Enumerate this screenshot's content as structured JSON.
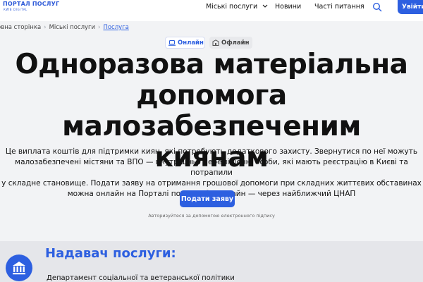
{
  "header": {
    "logo_title": "ПОРТАЛ ПОСЛУГ",
    "logo_subtitle": "КИЇВ DIGITAL",
    "nav": {
      "city_services": "Міські послуги",
      "news": "Новини",
      "faq": "Часті питання"
    },
    "login_label": "Увійти"
  },
  "breadcrumb": {
    "items": [
      "овна сторінка",
      "Міські послуги",
      "Послуга"
    ]
  },
  "mode": {
    "online": "Онлайн",
    "offline": "Офлайн"
  },
  "title": {
    "lines": [
      "Одноразова матеріальна",
      "допомога малозабезпеченим",
      "киянам"
    ]
  },
  "description": {
    "lines": [
      "Це виплата коштів для підтримки киян, які потребують додаткового захисту. Звернутися по неї можуть",
      "малозабезпечені містяни та ВПО — внутрішньо переміщенні особи, які мають реєстрацію в Києві та потрапили",
      "у складне становище. Подати заяву на отримання грошової допомоги при складних життєвих обставинах",
      "можна онлайн на Порталі послуг або офлайн — через найближчий ЦНАП"
    ]
  },
  "apply_label": "Подати заяву",
  "auth_note": "Авторизуйтеся за допомогою електронного підпису",
  "provider": {
    "title": "Надавач послуги:",
    "name": "Департамент соціальної та ветеранської політики"
  },
  "colors": {
    "accent": "#2d5fe0",
    "background": "#f2f3f5",
    "provider_bg": "#e5e6ea"
  },
  "icons": [
    "search-icon",
    "chevron-down-icon",
    "laptop-icon",
    "building-icon",
    "institution-icon"
  ]
}
